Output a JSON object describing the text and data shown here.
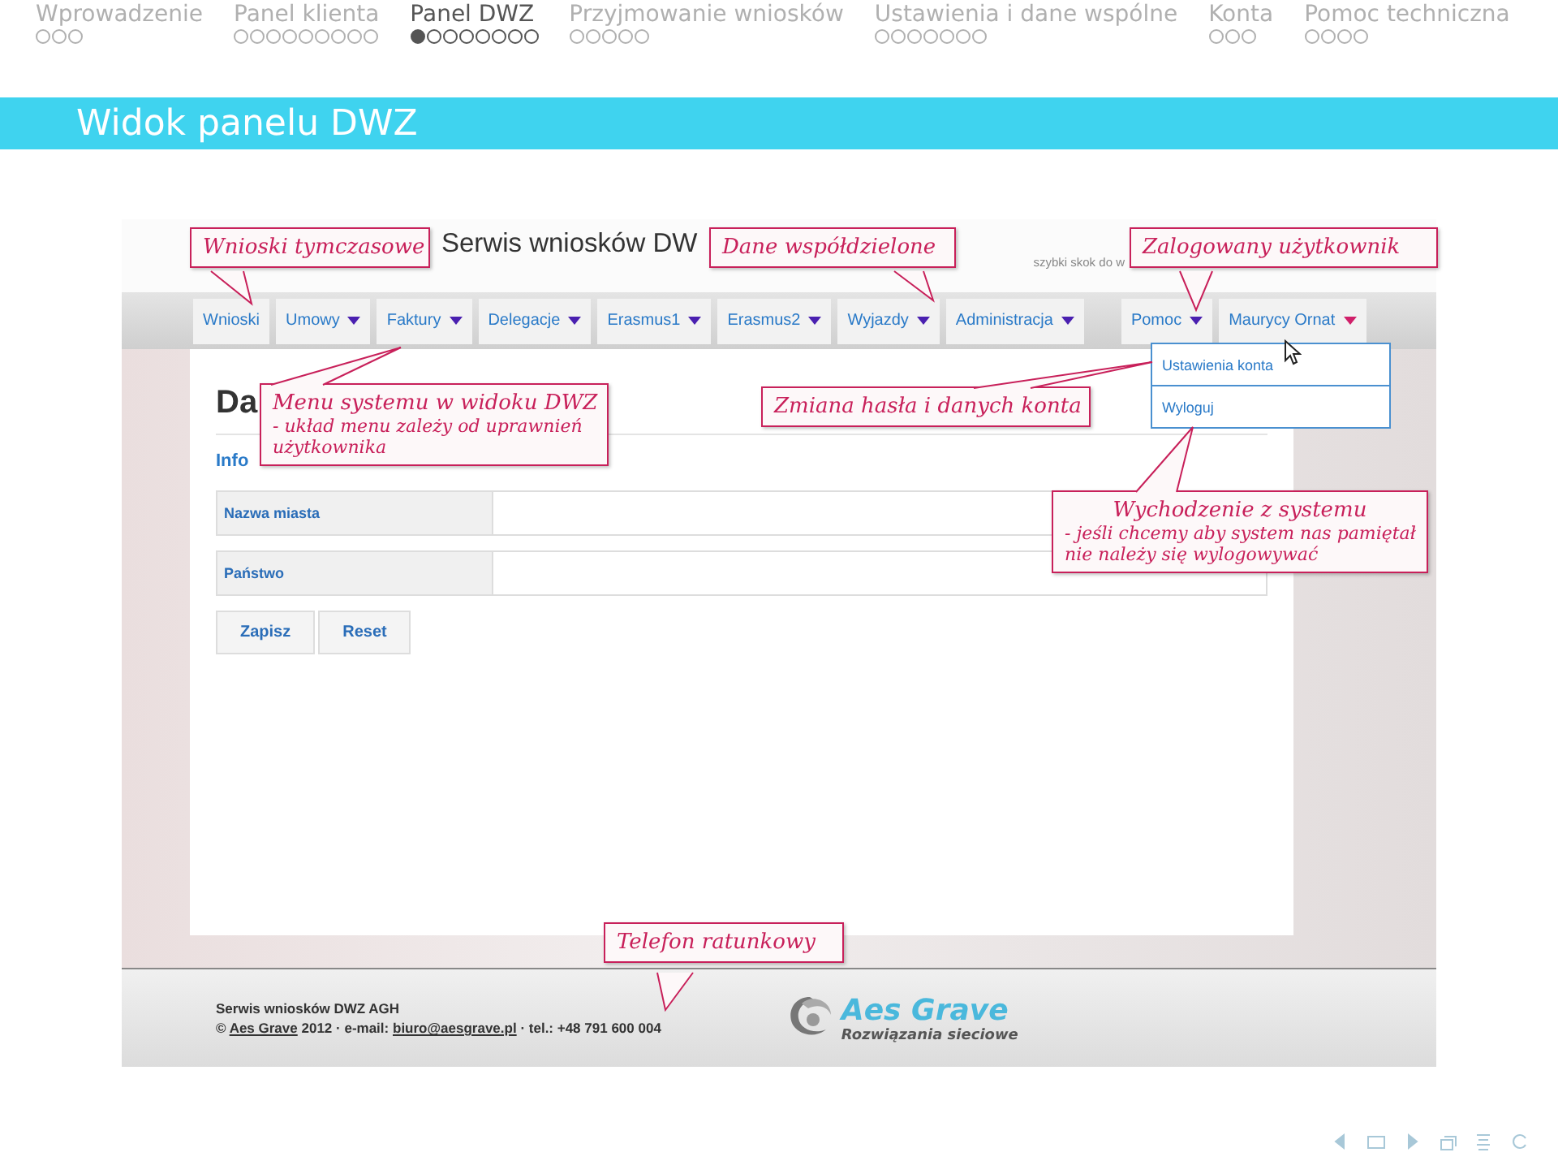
{
  "sections": [
    {
      "title": "Wprowadzenie",
      "selected": false,
      "slides": [
        {
          "selected": false
        },
        {
          "selected": false
        },
        {
          "selected": false
        }
      ]
    },
    {
      "title": "Panel klienta",
      "selected": false,
      "slides": [
        {
          "selected": false
        },
        {
          "selected": false
        },
        {
          "selected": false
        },
        {
          "selected": false
        },
        {
          "selected": false
        },
        {
          "selected": false
        },
        {
          "selected": false
        },
        {
          "selected": false
        },
        {
          "selected": false
        }
      ]
    },
    {
      "title": "Panel DWZ",
      "selected": true,
      "slides": [
        {
          "selected": true
        },
        {
          "selected": false
        },
        {
          "selected": false
        },
        {
          "selected": false
        },
        {
          "selected": false
        },
        {
          "selected": false
        },
        {
          "selected": false
        },
        {
          "selected": false
        }
      ]
    },
    {
      "title": "Przyjmowanie wniosków",
      "selected": false,
      "slides": [
        {
          "selected": false
        },
        {
          "selected": false
        },
        {
          "selected": false
        },
        {
          "selected": false
        },
        {
          "selected": false
        }
      ]
    },
    {
      "title": "Ustawienia i dane wspólne",
      "selected": false,
      "slides": [
        {
          "selected": false
        },
        {
          "selected": false
        },
        {
          "selected": false
        },
        {
          "selected": false
        },
        {
          "selected": false
        },
        {
          "selected": false
        },
        {
          "selected": false
        }
      ]
    },
    {
      "title": "Konta",
      "selected": false,
      "slides": [
        {
          "selected": false
        },
        {
          "selected": false
        },
        {
          "selected": false
        }
      ]
    },
    {
      "title": "Pomoc techniczna",
      "selected": false,
      "slides": [
        {
          "selected": false
        },
        {
          "selected": false
        },
        {
          "selected": false
        },
        {
          "selected": false
        }
      ]
    }
  ],
  "frame_title": "Widok panelu DWZ",
  "screenshot": {
    "site_title": "Serwis wniosków DW",
    "quick_jump": "szybki skok do w",
    "menu": {
      "main_items": [
        {
          "label": "Wnioski",
          "dropdown": false
        },
        {
          "label": "Umowy",
          "dropdown": true,
          "open": false
        },
        {
          "label": "Faktury",
          "dropdown": true,
          "open": false
        },
        {
          "label": "Delegacje",
          "dropdown": true,
          "open": false
        },
        {
          "label": "Erasmus1",
          "dropdown": true,
          "open": false
        },
        {
          "label": "Erasmus2",
          "dropdown": true,
          "open": false
        },
        {
          "label": "Wyjazdy",
          "dropdown": true,
          "open": false
        },
        {
          "label": "Administracja",
          "dropdown": true,
          "open": false
        }
      ],
      "right_items": [
        {
          "label": "Pomoc",
          "dropdown": true,
          "open": false
        },
        {
          "label": "Maurycy Ornat",
          "dropdown": true,
          "open": true
        }
      ]
    },
    "dropdown": [
      "Ustawienia konta",
      "Wyloguj"
    ],
    "heading": "Da",
    "subheading": "Info",
    "form": [
      {
        "label": "Nazwa miasta"
      },
      {
        "label": "Państwo"
      }
    ],
    "buttons": [
      "Zapisz",
      "Reset"
    ],
    "footer": {
      "title": "Serwis wniosków DWZ AGH",
      "prefix": "©",
      "link_1": "Aes Grave",
      "middle": "2012 · e-mail:",
      "link_2": "biuro@aesgrave.pl",
      "suffix": "· tel.: +48 791 600 004",
      "logo_name": "Aes Grave",
      "logo_tagline": "Rozwiązania sieciowe"
    },
    "callouts": [
      {
        "title": "Wnioski tymczasowe"
      },
      {
        "title": "Dane współdzielone"
      },
      {
        "title": "Zalogowany użytkownik"
      },
      {
        "title": "Menu systemu w widoku DWZ",
        "lines": [
          "- układ menu zależy od uprawnień",
          "użytkownika"
        ]
      },
      {
        "title": "Zmiana hasła i danych konta"
      },
      {
        "title": "Wychodzenie z systemu",
        "lines": [
          "- jeśli chcemy aby system nas  pamiętał",
          "nie należy się wylogowywać"
        ]
      },
      {
        "title": "Telefon ratunkowy"
      }
    ]
  }
}
